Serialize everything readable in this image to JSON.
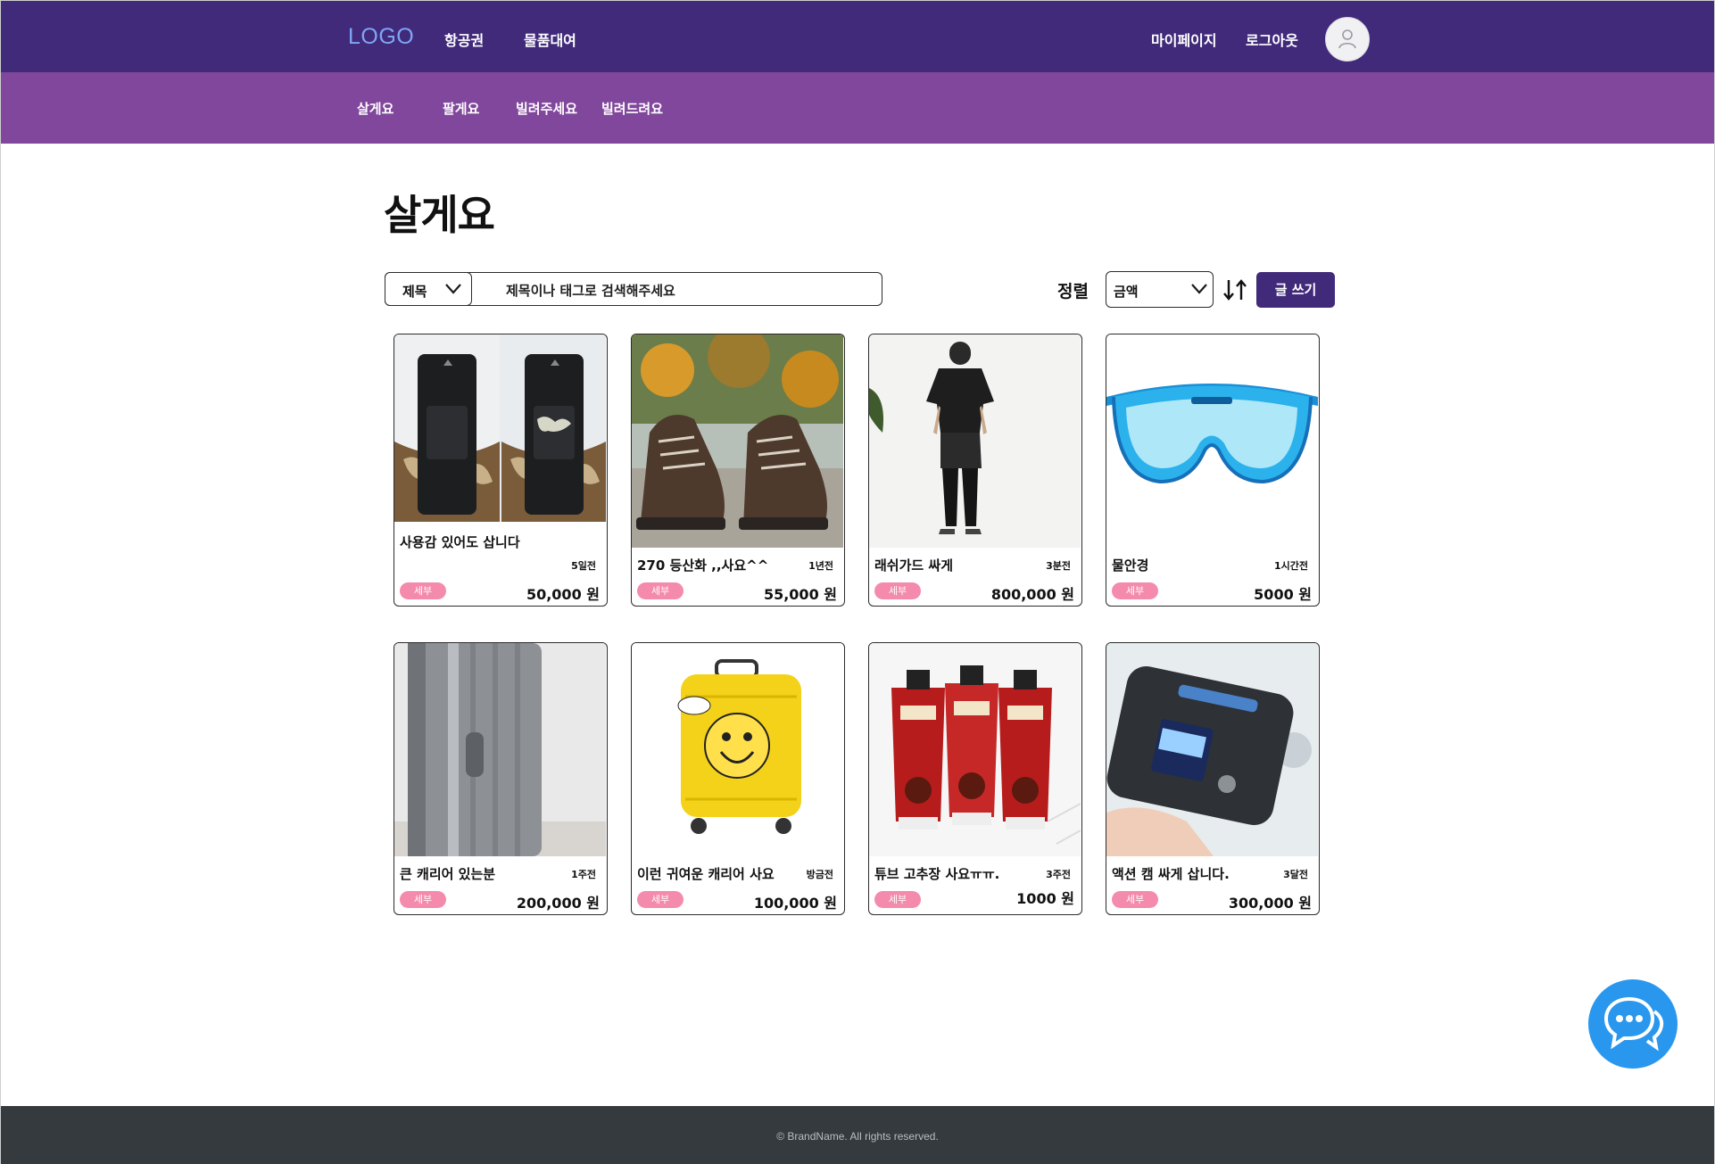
{
  "header": {
    "logo": "LOGO",
    "nav": [
      "항공권",
      "물품대여"
    ],
    "right": [
      "마이페이지",
      "로그아웃"
    ]
  },
  "subnav": [
    "살게요",
    "팔게요",
    "빌려주세요",
    "빌려드려요"
  ],
  "page": {
    "title": "살게요"
  },
  "search": {
    "field_value": "제목",
    "placeholder": "제목이나 태그로 검색해주세요"
  },
  "sort": {
    "label": "정렬",
    "value": "금액",
    "toggle_icon": "sort-arrows-icon"
  },
  "write_button": "글 쓰기",
  "products": [
    {
      "title": "사용감 있어도 삽니다",
      "time": "5일전",
      "tag": "세부",
      "price": "50,000 원",
      "image": "backpack"
    },
    {
      "title": "270 등산화 ,,사요^^",
      "time": "1년전",
      "tag": "세부",
      "price": "55,000 원",
      "image": "hiking-boots"
    },
    {
      "title": "래쉬가드 싸게",
      "time": "3분전",
      "tag": "세부",
      "price": "800,000 원",
      "image": "rashguard"
    },
    {
      "title": "물안경",
      "time": "1시간전",
      "tag": "세부",
      "price": "5000 원",
      "image": "swim-goggles"
    },
    {
      "title": "큰 캐리어 있는분",
      "time": "1주전",
      "tag": "세부",
      "price": "200,000 원",
      "image": "suitcase-gray"
    },
    {
      "title": "이런 귀여운 캐리어 사요",
      "time": "방금전",
      "tag": "세부",
      "price": "100,000 원",
      "image": "suitcase-yellow"
    },
    {
      "title": "튜브 고추장 사요ㅠㅠ.",
      "time": "3주전",
      "tag": "세부",
      "price": "1000 원",
      "image": "gochujang-tubes"
    },
    {
      "title": "액션 캠 싸게 삽니다.",
      "time": "3달전",
      "tag": "세부",
      "price": "300,000 원",
      "image": "wifi-router"
    }
  ],
  "footer": {
    "copyright": "© BrandName. All rights reserved."
  },
  "colors": {
    "topbar": "#412a7a",
    "subbar": "#80479c",
    "tag": "#f48aac",
    "chat": "#2a97ee",
    "footer": "#343a3d"
  }
}
